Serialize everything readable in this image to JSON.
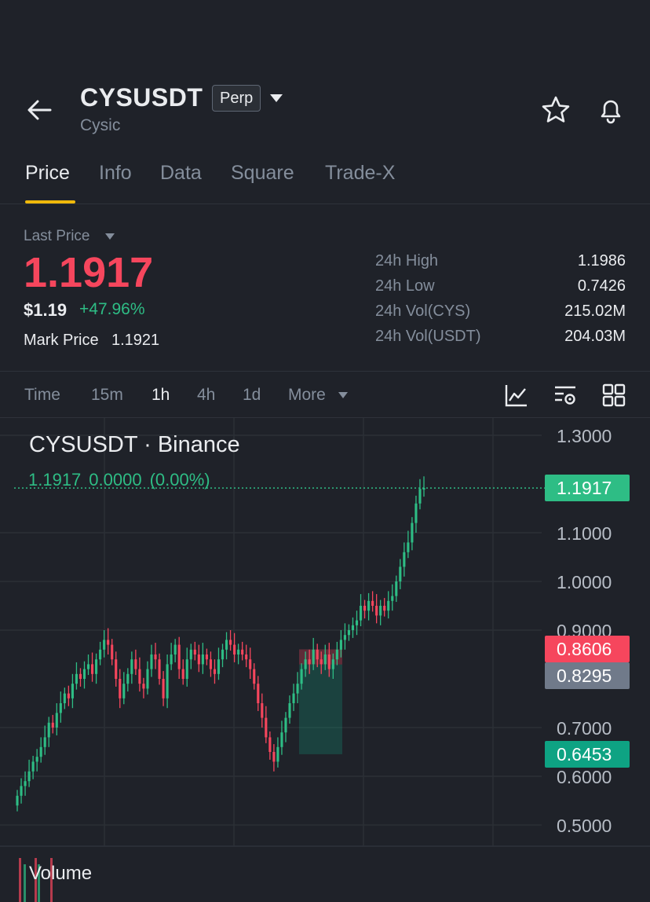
{
  "header": {
    "symbol": "CYSUSDT",
    "contract_type": "Perp",
    "name": "Cysic"
  },
  "tabs": [
    "Price",
    "Info",
    "Data",
    "Square",
    "Trade-X"
  ],
  "active_tab": "Price",
  "price_panel": {
    "last_price_label": "Last Price",
    "last_price": "1.1917",
    "usd_price": "$1.19",
    "change_pct": "+47.96%",
    "mark_price_label": "Mark Price",
    "mark_price": "1.1921"
  },
  "stats": [
    {
      "label": "24h High",
      "value": "1.1986"
    },
    {
      "label": "24h Low",
      "value": "0.7426"
    },
    {
      "label": "24h Vol(CYS)",
      "value": "215.02M"
    },
    {
      "label": "24h Vol(USDT)",
      "value": "204.03M"
    }
  ],
  "timeframes": {
    "items": [
      "Time",
      "15m",
      "1h",
      "4h",
      "1d",
      "More"
    ],
    "active": "1h"
  },
  "colors": {
    "up": "#2ebd85",
    "down": "#f6465d",
    "accent": "#f0b90b",
    "background": "#1f2229"
  },
  "chart": {
    "title": "CYSUSDT · Binance",
    "ohlc_price": "1.1917",
    "ohlc_change": "0.0000",
    "ohlc_change_pct": "(0.00%)",
    "volume_label": "Volume",
    "axis_ticks": [
      "1.3000",
      "1.1000",
      "1.0000",
      "0.9000",
      "0.7000",
      "0.6000",
      "0.5000"
    ],
    "price_tags": [
      {
        "value": "1.1917",
        "color": "#2ebd85"
      },
      {
        "value": "0.8606",
        "color": "#f6465d"
      },
      {
        "value": "0.8295",
        "color": "#707a8a"
      },
      {
        "value": "0.6453",
        "color": "#0ea383"
      }
    ]
  },
  "chart_data": {
    "type": "candlestick",
    "interval": "1h",
    "y_range": [
      0.5,
      1.3
    ],
    "y_ticks": [
      0.5,
      0.6,
      0.7,
      0.9,
      1.0,
      1.1,
      1.3
    ],
    "last_price": 1.1917,
    "close": [
      0.56,
      0.58,
      0.59,
      0.61,
      0.63,
      0.64,
      0.66,
      0.68,
      0.71,
      0.7,
      0.73,
      0.75,
      0.77,
      0.76,
      0.79,
      0.81,
      0.8,
      0.82,
      0.83,
      0.81,
      0.84,
      0.86,
      0.88,
      0.87,
      0.84,
      0.8,
      0.76,
      0.79,
      0.81,
      0.84,
      0.82,
      0.79,
      0.78,
      0.82,
      0.85,
      0.84,
      0.8,
      0.76,
      0.83,
      0.85,
      0.87,
      0.82,
      0.8,
      0.84,
      0.86,
      0.85,
      0.83,
      0.85,
      0.84,
      0.82,
      0.81,
      0.84,
      0.86,
      0.88,
      0.87,
      0.85,
      0.86,
      0.85,
      0.84,
      0.82,
      0.79,
      0.75,
      0.72,
      0.68,
      0.65,
      0.63,
      0.66,
      0.69,
      0.72,
      0.75,
      0.77,
      0.79,
      0.82,
      0.84,
      0.83,
      0.86,
      0.84,
      0.83,
      0.85,
      0.82,
      0.84,
      0.86,
      0.88,
      0.89,
      0.9,
      0.91,
      0.92,
      0.95,
      0.94,
      0.96,
      0.95,
      0.93,
      0.95,
      0.94,
      0.96,
      0.97,
      1.0,
      1.03,
      1.06,
      1.08,
      1.12,
      1.16,
      1.19,
      1.1917
    ],
    "events": {
      "high_24h": 1.1986,
      "low_24h": 0.7426
    }
  }
}
